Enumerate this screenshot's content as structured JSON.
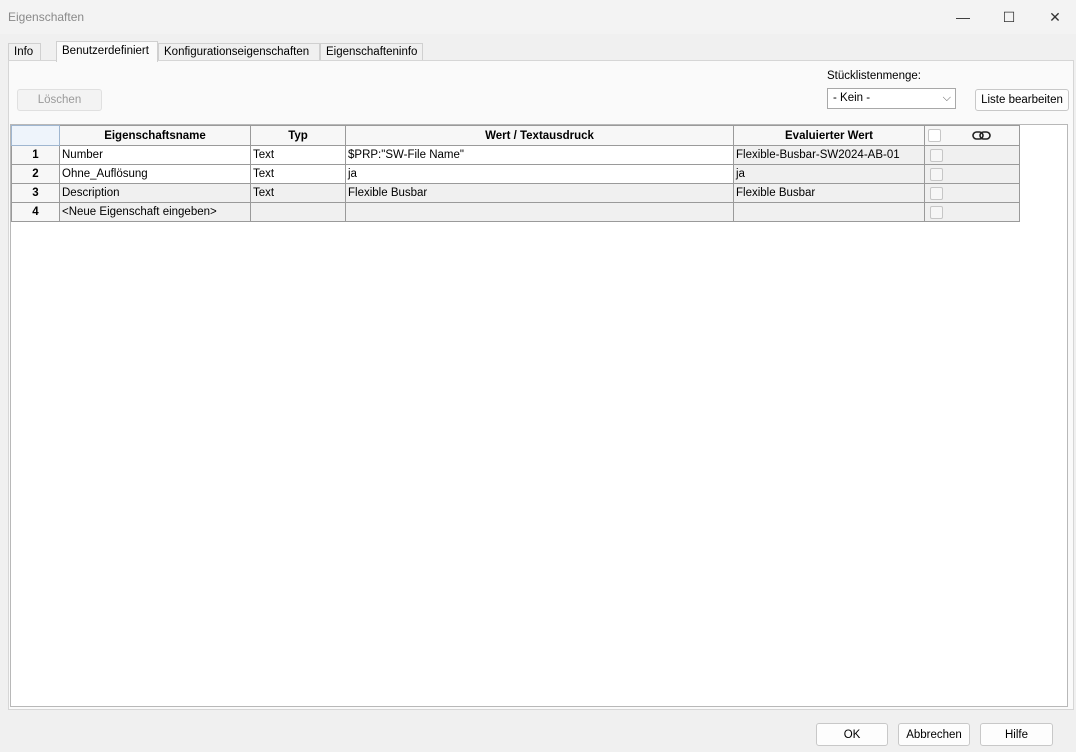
{
  "window": {
    "title": "Eigenschaften"
  },
  "window_controls": {
    "minimize": "—",
    "maximize": "☐",
    "close": "✕"
  },
  "tabs": [
    {
      "label": "Info"
    },
    {
      "label": "Benutzerdefiniert"
    },
    {
      "label": "Konfigurationseigenschaften"
    },
    {
      "label": "Eigenschafteninfo"
    }
  ],
  "toolbar": {
    "delete_label": "Löschen",
    "bom_qty_label": "Stücklistenmenge:",
    "bom_qty_value": "- Kein -",
    "edit_list_label": "Liste bearbeiten"
  },
  "grid": {
    "headers": [
      "Eigenschaftsname",
      "Typ",
      "Wert / Textausdruck",
      "Evaluierter Wert"
    ],
    "link_icon": "link-icon",
    "rows": [
      {
        "num": "1",
        "name": "Number",
        "type": "Text",
        "value": "$PRP:\"SW-File Name\"",
        "evaluated": "Flexible-Busbar-SW2024-AB-01"
      },
      {
        "num": "2",
        "name": "Ohne_Auflösung",
        "type": "Text",
        "value": "ja",
        "evaluated": "ja"
      },
      {
        "num": "3",
        "name": "Description",
        "type": "Text",
        "value": "Flexible Busbar",
        "evaluated": "Flexible Busbar"
      },
      {
        "num": "4",
        "name": "<Neue Eigenschaft eingeben>",
        "type": "",
        "value": "",
        "evaluated": ""
      }
    ]
  },
  "footer": {
    "ok_label": "OK",
    "cancel_label": "Abbrechen",
    "help_label": "Hilfe"
  }
}
